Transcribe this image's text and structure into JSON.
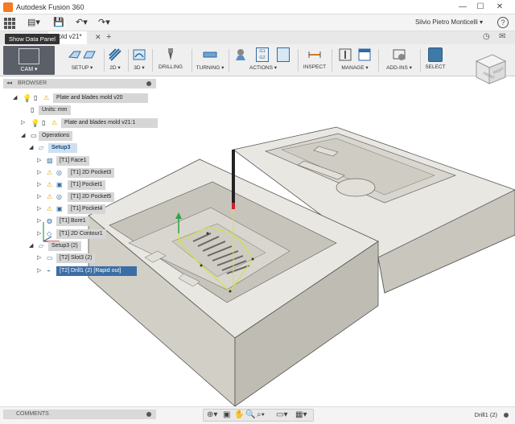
{
  "window": {
    "title": "Autodesk Fusion 360",
    "controls": [
      "—",
      "☐",
      "✕"
    ]
  },
  "quickbar": {
    "user": "Silvio Pietro Monticelli ▾",
    "help": "?"
  },
  "tabs": {
    "document_tab": "mold v21*",
    "tooltip": "Show Data Panel"
  },
  "toolbar": {
    "cam_label": "CAM ▾",
    "groups": [
      {
        "label": "SETUP ▾",
        "icon": "setup-icon"
      },
      {
        "label": "2D ▾",
        "icon": "2d-icon"
      },
      {
        "label": "3D ▾",
        "icon": "3d-icon"
      },
      {
        "label": "DRILLING",
        "icon": "drill-icon"
      },
      {
        "label": "TURNING ▾",
        "icon": "turning-icon"
      },
      {
        "label": "ACTIONS ▾",
        "icon": "actions-icon"
      },
      {
        "label": "INSPECT",
        "icon": "inspect-icon"
      },
      {
        "label": "MANAGE ▾",
        "icon": "manage-icon"
      },
      {
        "label": "ADD-INS ▾",
        "icon": "addins-icon"
      },
      {
        "label": "SELECT",
        "icon": "select-icon"
      }
    ],
    "g2g3": [
      "G1",
      "G2"
    ]
  },
  "viewcube": {
    "face_front": "FRONT",
    "face_right": "RIGHT"
  },
  "browser": {
    "title": "BROWSER",
    "items": [
      {
        "label": "Plate and blades mold v20",
        "warn": true
      },
      {
        "label": "Units: mm"
      },
      {
        "label": "Plate and blades mold v21:1",
        "warn": true
      },
      {
        "label": "Operations"
      },
      {
        "label": "Setup3"
      },
      {
        "label": "[T1] Face1"
      },
      {
        "label": "[T1] 2D Pocket3",
        "warn": true
      },
      {
        "label": "[T1] Pocket1",
        "warn": true
      },
      {
        "label": "[T1] 2D Pocket5",
        "warn": true
      },
      {
        "label": "[T1] Pocket4",
        "warn": true
      },
      {
        "label": "[T1] Bore1"
      },
      {
        "label": "[T1] 2D Contour1"
      },
      {
        "label": "Setup3 (2)"
      },
      {
        "label": "[T2] Slot3 (2)"
      },
      {
        "label": "[T2] Drill1 (2) [Rapid out]"
      }
    ]
  },
  "comments": {
    "title": "COMMENTS"
  },
  "status": {
    "right_label": "Drill1 (2)"
  },
  "colors": {
    "accent": "#3b6ea5",
    "part_top": "#e9e7e1",
    "part_side": "#c9c6bd",
    "toolpath": "#d4e04a"
  }
}
